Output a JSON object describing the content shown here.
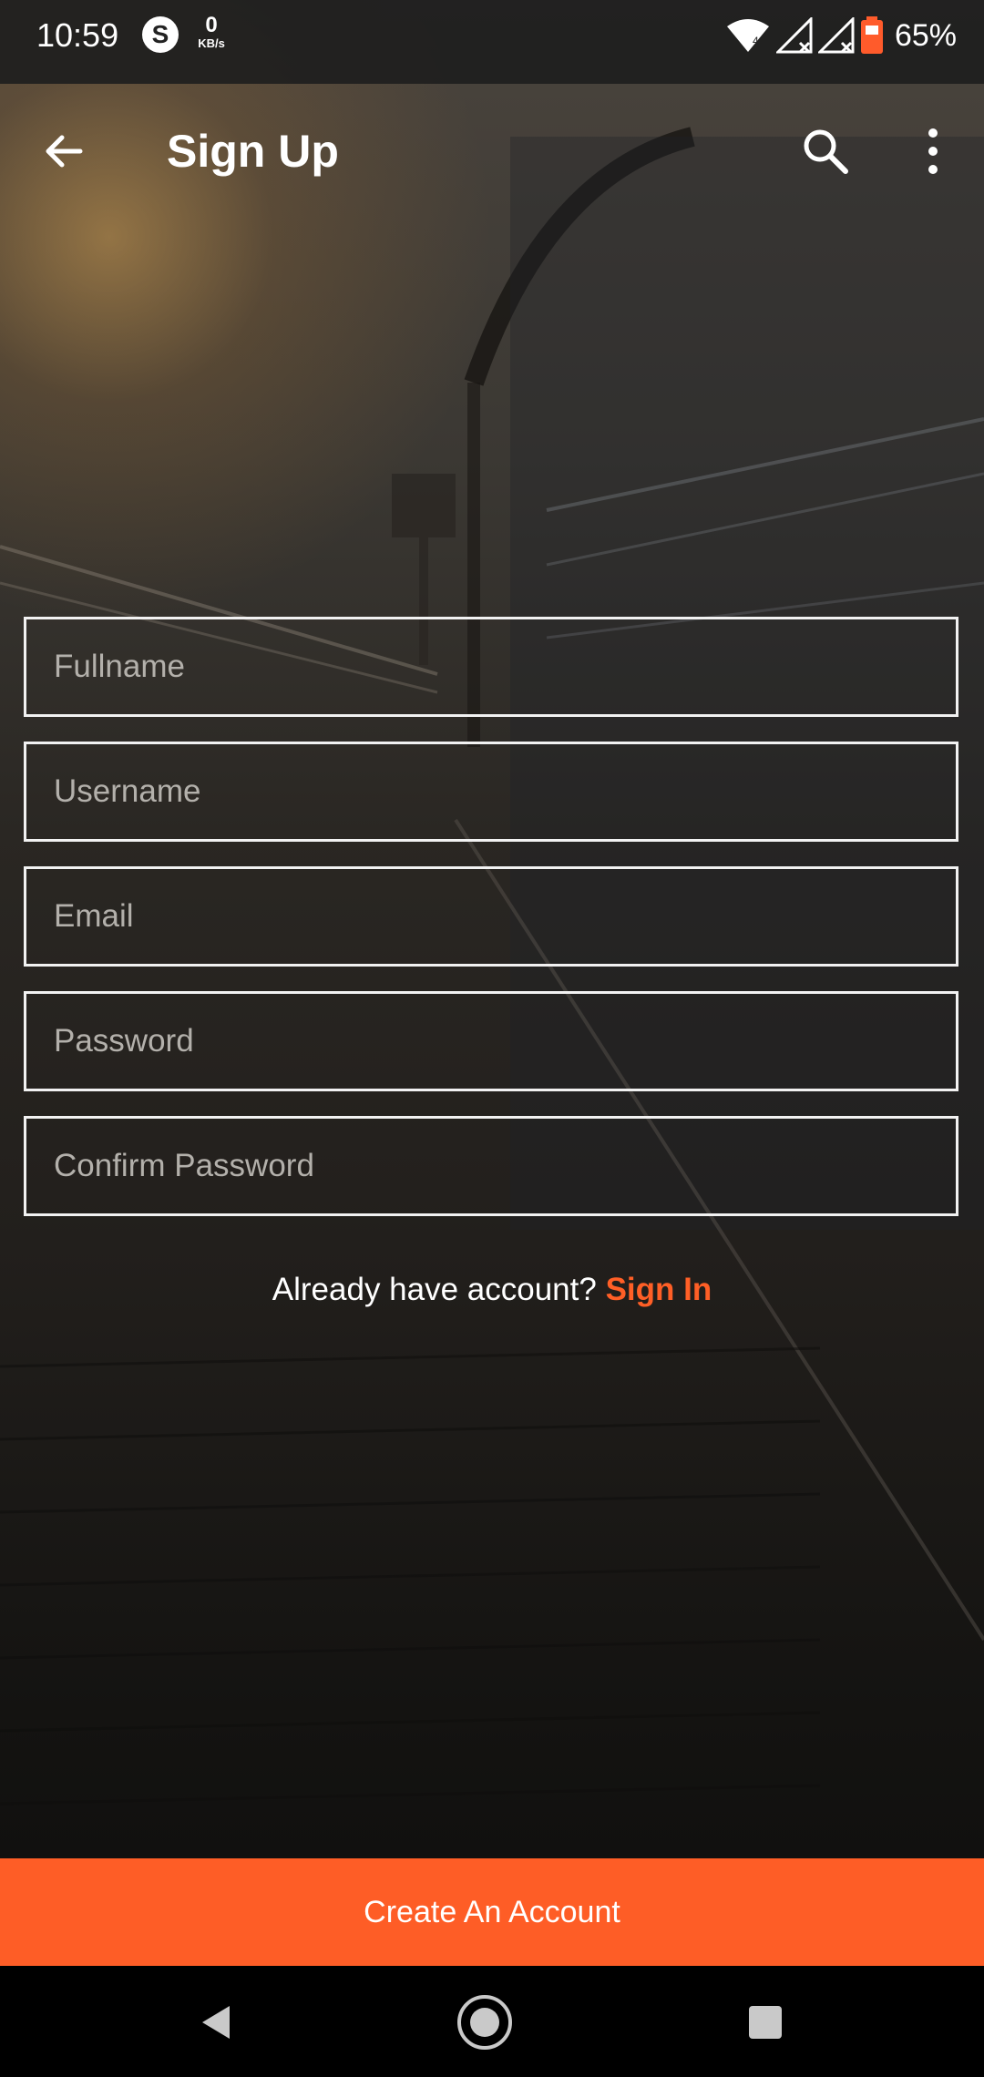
{
  "status_bar": {
    "time": "10:59",
    "skype_letter": "S",
    "net_speed_value": "0",
    "net_speed_unit": "KB/s",
    "battery_percent": "65%",
    "icons": [
      "wifi-icon",
      "signal-1-icon",
      "signal-2-icon",
      "battery-icon"
    ]
  },
  "app_bar": {
    "title": "Sign Up",
    "icons": [
      "back-arrow-icon",
      "search-icon",
      "more-vert-icon"
    ]
  },
  "form": {
    "fullname_placeholder": "Fullname",
    "username_placeholder": "Username",
    "email_placeholder": "Email",
    "password_placeholder": "Password",
    "confirm_password_placeholder": "Confirm Password"
  },
  "signin_prompt": {
    "text": "Already have account?",
    "link": "Sign In"
  },
  "cta": {
    "label": "Create An Account"
  },
  "nav_bar": {
    "icons": [
      "nav-back-icon",
      "nav-home-icon",
      "nav-recents-icon"
    ]
  },
  "colors": {
    "accent": "#fe5d26",
    "field_border": "#f2f2f2"
  }
}
